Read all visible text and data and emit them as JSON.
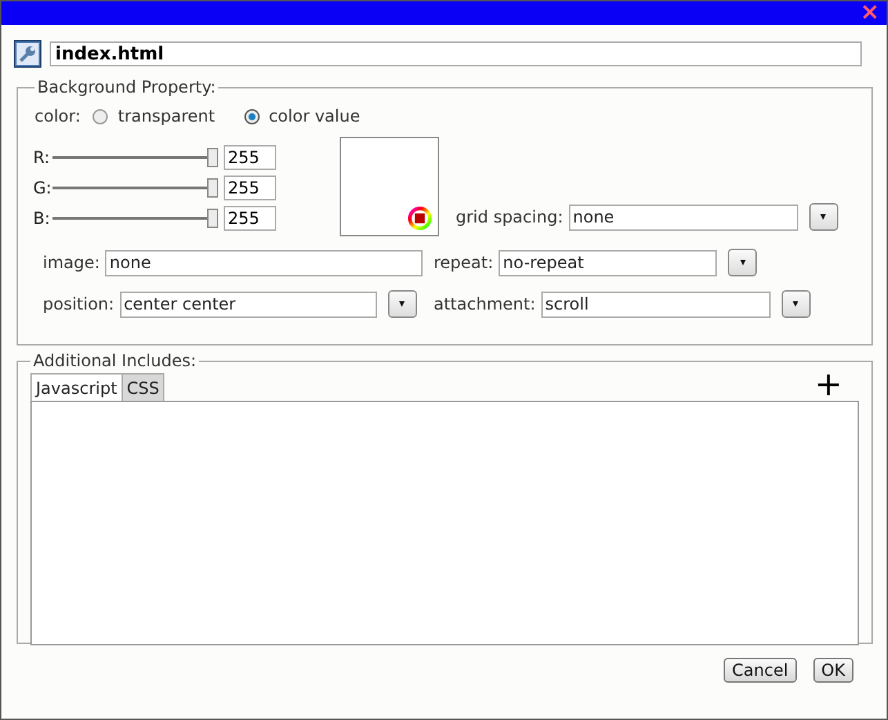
{
  "close": "×",
  "file": {
    "value": "index.html"
  },
  "background": {
    "legend": "Background Property:",
    "color_label": "color:",
    "color_modes": [
      {
        "label": "transparent",
        "selected": false
      },
      {
        "label": "color value",
        "selected": true
      }
    ],
    "sliders": [
      {
        "label": "R:",
        "level": 1,
        "value": "255"
      },
      {
        "label": "G:",
        "level": 1,
        "value": "255"
      },
      {
        "label": "B:",
        "level": 1,
        "value": "255"
      }
    ],
    "grid_spacing": {
      "label": "grid spacing:",
      "value": "none"
    },
    "image": {
      "label": "image:",
      "value": "none"
    },
    "repeat": {
      "label": "repeat:",
      "value": "no-repeat"
    },
    "position": {
      "label": "position:",
      "value": "center center"
    },
    "attachment": {
      "label": "attachment:",
      "value": "scroll"
    }
  },
  "includes": {
    "legend": "Additional Includes:",
    "add": "+",
    "tabs": [
      {
        "label": "Javascript",
        "selected": true
      },
      {
        "label": "CSS",
        "selected": false
      }
    ]
  },
  "buttons": [
    "Cancel",
    "OK"
  ]
}
